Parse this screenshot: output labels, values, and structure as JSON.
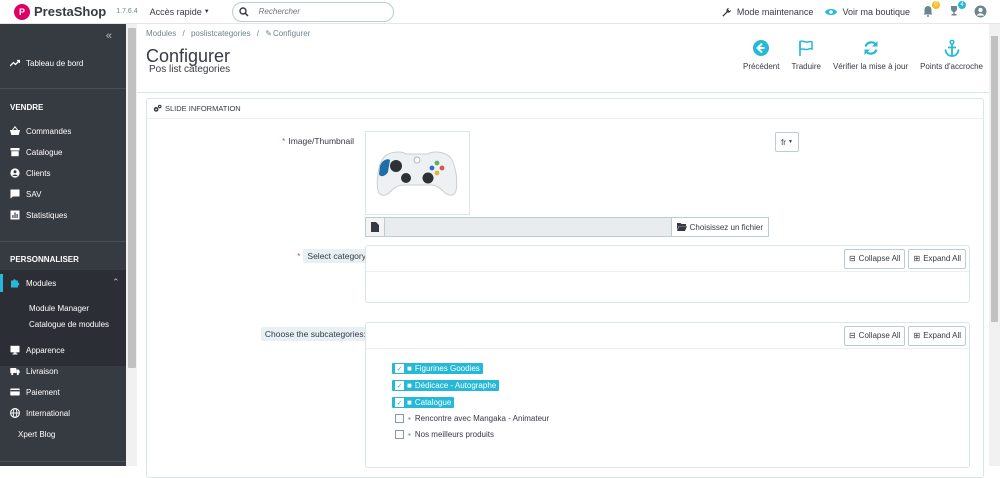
{
  "topbar": {
    "logo": "PrestaShop",
    "version": "1.7.6.4",
    "quick_access": "Accès rapide",
    "search_placeholder": "Rechercher",
    "maintenance": "Mode maintenance",
    "view_shop": "Voir ma boutique",
    "notif_count": "0",
    "orders_count": "4"
  },
  "sidebar": {
    "collapse": "«",
    "dashboard": "Tableau de bord",
    "section_sell": "VENDRE",
    "orders": "Commandes",
    "catalog": "Catalogue",
    "customers": "Clients",
    "sav": "SAV",
    "stats": "Statistiques",
    "section_custom": "PERSONNALISER",
    "modules": "Modules",
    "module_manager": "Module Manager",
    "module_catalog": "Catalogue de modules",
    "appearance": "Apparence",
    "shipping": "Livraison",
    "payment": "Paiement",
    "international": "International",
    "xpert_blog": "Xpert Blog"
  },
  "header": {
    "crumb1": "Modules",
    "crumb_sep": "/",
    "crumb2": "poslistcategories",
    "crumb3": "Configurer",
    "title": "Configurer",
    "subtitle": "Pos list categories"
  },
  "toolbar": {
    "back": "Précédent",
    "translate": "Traduire",
    "check_update": "Vérifier la mise à jour",
    "hooks": "Points d'accroche"
  },
  "panel": {
    "heading": "SLIDE INFORMATION",
    "required_mark": "*",
    "image_label": "Image/Thumbnail",
    "lang": "fr",
    "choose_file": "Choisissez un fichier",
    "select_category_label": "Select category",
    "subcategories_label": "Choose the subcategories:",
    "collapse_all": "Collapse All",
    "expand_all": "Expand All",
    "tree_items": [
      {
        "label": "Figurines Goodies",
        "checked": true
      },
      {
        "label": "Dédicace - Autographe",
        "checked": true
      },
      {
        "label": "Catalogue",
        "checked": true
      },
      {
        "label": "Rencontre avec Mangaka - Animateur",
        "checked": false
      },
      {
        "label": "Nos meilleurs produits",
        "checked": false
      }
    ]
  },
  "colors": {
    "accent": "#25b9d7",
    "sidebar": "#363a41",
    "brand": "#df0067"
  }
}
